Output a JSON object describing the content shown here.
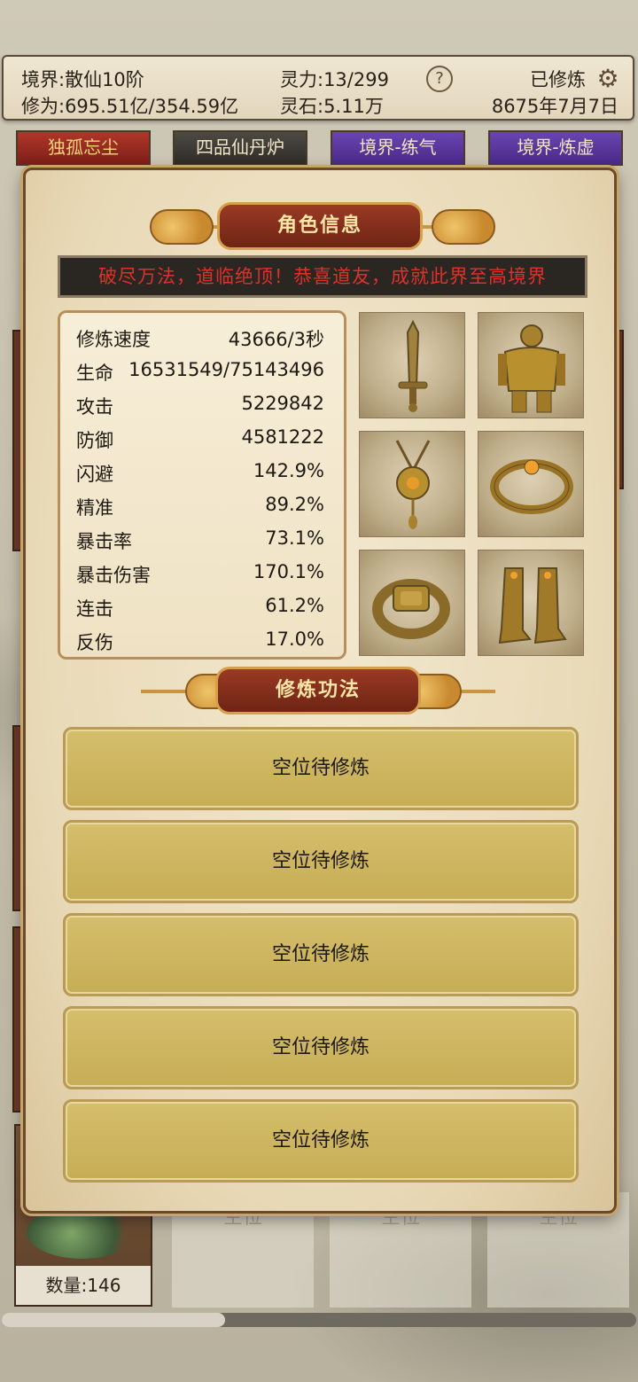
{
  "topbar": {
    "realm": "境界:散仙10阶",
    "cultivation": "修为:695.51亿/354.59亿",
    "spirit_power": "灵力:13/299",
    "spirit_stone": "灵石:5.11万",
    "help_label": "?",
    "status": "已修炼",
    "date": "8675年7月7日"
  },
  "tabs": [
    "独孤忘尘",
    "四品仙丹炉",
    "境界-练气",
    "境界-炼虚"
  ],
  "herb": {
    "qty_label": "数量:146"
  },
  "background_slots": [
    "空位",
    "空位",
    "空位"
  ],
  "modal": {
    "title": "角色信息",
    "notice": "破尽万法，道临绝顶！恭喜道友，成就此界至高境界",
    "stats": [
      {
        "label": "修炼速度",
        "value": "43666/3秒"
      },
      {
        "label": "生命",
        "value": "16531549/75143496"
      },
      {
        "label": "攻击",
        "value": "5229842"
      },
      {
        "label": "防御",
        "value": "4581222"
      },
      {
        "label": "闪避",
        "value": "142.9%"
      },
      {
        "label": "精准",
        "value": "89.2%"
      },
      {
        "label": "暴击率",
        "value": "73.1%"
      },
      {
        "label": "暴击伤害",
        "value": "170.1%"
      },
      {
        "label": "连击",
        "value": "61.2%"
      },
      {
        "label": "反伤",
        "value": "17.0%"
      }
    ],
    "equipment": [
      "sword",
      "armor",
      "amulet",
      "bracelet",
      "ring",
      "boots"
    ],
    "skills_title": "修炼功法",
    "skill_slots": [
      "空位待修炼",
      "空位待修炼",
      "空位待修炼",
      "空位待修炼",
      "空位待修炼"
    ]
  },
  "colors": {
    "banner": "#7d2a18",
    "notice_text": "#e0302a",
    "skill_slot": "#cdb462",
    "parchment": "#f3e8cf"
  }
}
